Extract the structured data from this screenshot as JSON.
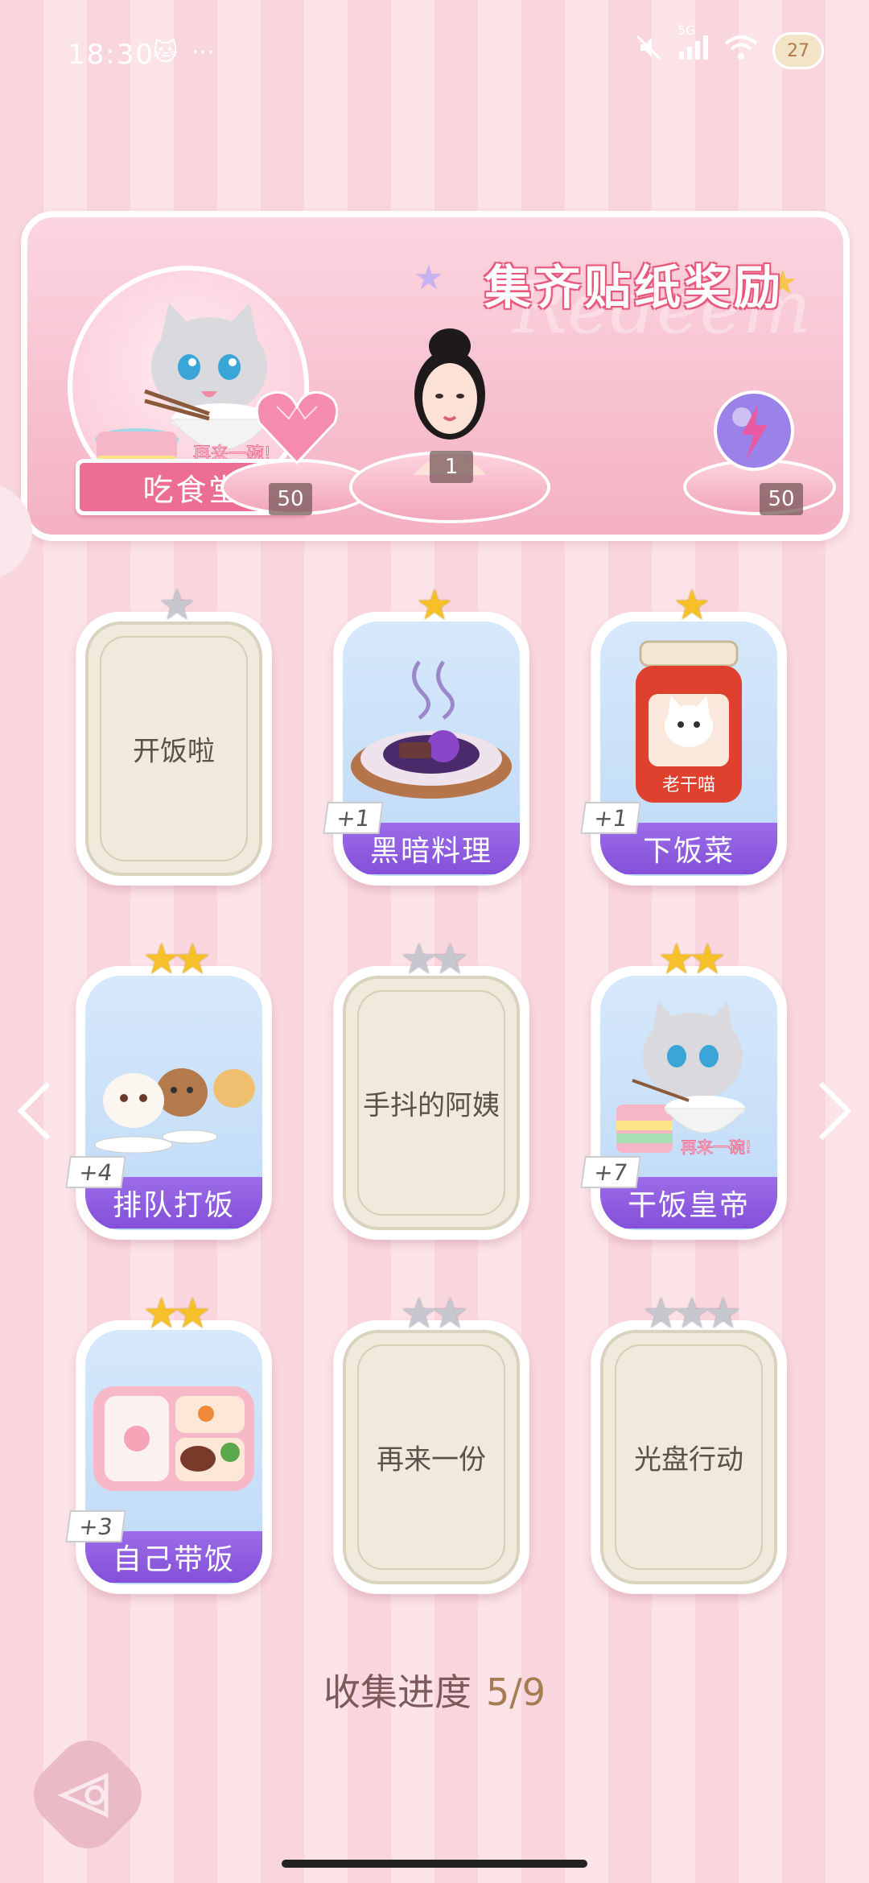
{
  "status_bar": {
    "time": "18:30",
    "left_icons": [
      "cat-icon",
      "more-icon"
    ],
    "right_icons": [
      "mute-icon",
      "signal-icon",
      "wifi-icon"
    ],
    "network": "5G",
    "battery": "27"
  },
  "banner": {
    "title": "集齐贴纸奖励",
    "watermark": "Redeem",
    "category_label": "吃食堂",
    "cat_caption": "再来一碗!",
    "rewards": [
      {
        "name": "heart-gem-icon",
        "count": "50"
      },
      {
        "name": "character-portrait",
        "count": "1"
      },
      {
        "name": "energy-orb-icon",
        "count": "50"
      }
    ]
  },
  "cards": [
    {
      "title": "开饭啦",
      "stars": 1,
      "filled_stars": 0,
      "collected": false
    },
    {
      "title": "黑暗料理",
      "stars": 1,
      "filled_stars": 1,
      "collected": true,
      "count": "+1",
      "art": "dark-food-art"
    },
    {
      "title": "下饭菜",
      "stars": 1,
      "filled_stars": 1,
      "collected": true,
      "count": "+1",
      "art": "sauce-jar-art",
      "jar_label": "老干喵"
    },
    {
      "title": "排队打饭",
      "stars": 2,
      "filled_stars": 2,
      "collected": true,
      "count": "+4",
      "art": "queue-cats-art"
    },
    {
      "title": "手抖的阿姨",
      "stars": 2,
      "filled_stars": 0,
      "collected": false
    },
    {
      "title": "干饭皇帝",
      "stars": 2,
      "filled_stars": 2,
      "collected": true,
      "count": "+7",
      "art": "eating-cat-art",
      "caption": "再来一碗!"
    },
    {
      "title": "自己带饭",
      "stars": 2,
      "filled_stars": 2,
      "collected": true,
      "count": "+3",
      "art": "bento-box-art"
    },
    {
      "title": "再来一份",
      "stars": 2,
      "filled_stars": 0,
      "collected": false
    },
    {
      "title": "光盘行动",
      "stars": 3,
      "filled_stars": 0,
      "collected": false
    }
  ],
  "progress": {
    "label": "收集进度",
    "value": "5/9"
  },
  "colors": {
    "ribbon": "#8a58dc",
    "gold_star": "#f5c02a",
    "pink_bg": "#f9d6de",
    "label_pink": "#ec6f93"
  }
}
